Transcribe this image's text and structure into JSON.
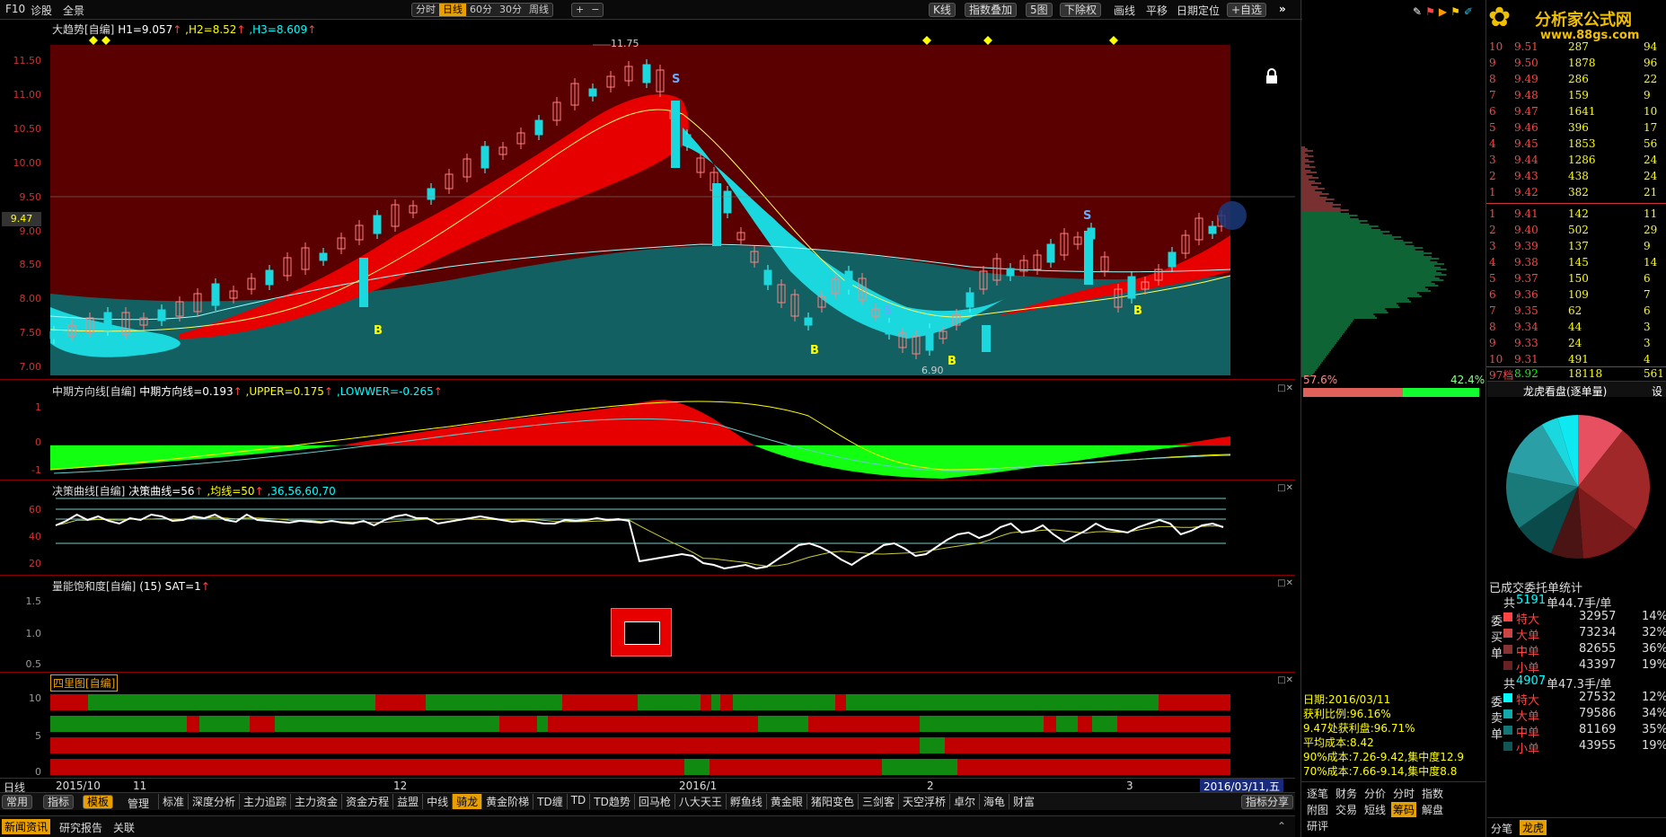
{
  "toolbar": {
    "f10": "F10",
    "diag": "诊股",
    "full": "全景",
    "periods": [
      "分时",
      "日线",
      "60分",
      "30分",
      "周线"
    ],
    "active_period": "日线",
    "zoom_in": "+",
    "zoom_out": "−",
    "right": [
      "K线",
      "指数叠加",
      "5图",
      "下除权",
      "画线",
      "平移",
      "日期定位",
      "+自选"
    ]
  },
  "main": {
    "title": "大趋势[自编]",
    "h1": "H1=9.057",
    "h2": ",H2=8.52",
    "h3": ",H3=8.609",
    "yticks": [
      "11.50",
      "11.00",
      "10.50",
      "10.00",
      "9.50",
      "9.00",
      "8.50",
      "8.00",
      "7.50",
      "7.00"
    ],
    "cur_price": "9.47",
    "high_label": "11.75",
    "low_label": "6.90",
    "s_label": "S",
    "b_label": "B"
  },
  "p2": {
    "title": "中期方向线[自编]",
    "v1": "中期方向线=0.193",
    "v2": ",UPPER=0.175",
    "v3": ",LOWWER=-0.265",
    "yticks": [
      "1",
      "0",
      "-1"
    ]
  },
  "p3": {
    "title": "决策曲线[自编]",
    "v1": "决策曲线=56",
    "v2": ",均线=50",
    "v3": ",36,56,60,70",
    "yticks": [
      "60",
      "40",
      "20"
    ]
  },
  "p4": {
    "title": "量能饱和度[自编]",
    "v1": "(15)",
    "v2": "SAT=1",
    "yticks": [
      "1.5",
      "1.0",
      "0.5"
    ]
  },
  "p5": {
    "title": "四里图[自编]",
    "yticks": [
      "10",
      "5",
      "0"
    ]
  },
  "xaxis": {
    "period": "日线",
    "labels": [
      "2015/10",
      "11",
      "12",
      "2016/1",
      "2",
      "3"
    ],
    "cur_date": "2016/03/11,五"
  },
  "bottom_tabs": {
    "common": "常用",
    "indicator": "指标",
    "template": "模板",
    "manage": "管理",
    "items": [
      "标准",
      "深度分析",
      "主力追踪",
      "主力资金",
      "资金方程",
      "益盟",
      "中线",
      "骑龙",
      "黄金阶梯",
      "TD缠",
      "TD",
      "TD趋势",
      "回马枪",
      "八大天王",
      "孵鱼线",
      "黄金眼",
      "猪阳变色",
      "三剑客",
      "天空浮桥",
      "卓尔",
      "海龟",
      "财富"
    ],
    "active": "骑龙",
    "share": "指标分享"
  },
  "news_tabs": [
    "新闻资讯",
    "研究报告",
    "关联"
  ],
  "chips": {
    "pct_left": "57.6%",
    "pct_right": "42.4%",
    "info": [
      "日期:2016/03/11",
      "获利比例:96.16%",
      "9.47处获利盘:96.71%",
      "平均成本:8.42",
      "90%成本:7.26-9.42,集中度12.9",
      "70%成本:7.66-9.14,集中度8.8"
    ],
    "tabs": [
      "逐笔",
      "财务",
      "分价",
      "分时",
      "指数",
      "附图",
      "交易",
      "短线",
      "筹码",
      "解盘",
      "研评"
    ],
    "active_tab": "筹码"
  },
  "orderbook": {
    "rows": [
      {
        "n": "10",
        "p": "9.51",
        "v": "287",
        "c": "94"
      },
      {
        "n": "9",
        "p": "9.50",
        "v": "1878",
        "c": "96"
      },
      {
        "n": "8",
        "p": "9.49",
        "v": "286",
        "c": "22"
      },
      {
        "n": "7",
        "p": "9.48",
        "v": "159",
        "c": "9"
      },
      {
        "n": "6",
        "p": "9.47",
        "v": "1641",
        "c": "10"
      },
      {
        "n": "5",
        "p": "9.46",
        "v": "396",
        "c": "17"
      },
      {
        "n": "4",
        "p": "9.45",
        "v": "1853",
        "c": "56"
      },
      {
        "n": "3",
        "p": "9.44",
        "v": "1286",
        "c": "24"
      },
      {
        "n": "2",
        "p": "9.43",
        "v": "438",
        "c": "24"
      },
      {
        "n": "1",
        "p": "9.42",
        "v": "382",
        "c": "21"
      },
      {
        "n": "1",
        "p": "9.41",
        "v": "142",
        "c": "11"
      },
      {
        "n": "2",
        "p": "9.40",
        "v": "502",
        "c": "29"
      },
      {
        "n": "3",
        "p": "9.39",
        "v": "137",
        "c": "9"
      },
      {
        "n": "4",
        "p": "9.38",
        "v": "145",
        "c": "14"
      },
      {
        "n": "5",
        "p": "9.37",
        "v": "150",
        "c": "6"
      },
      {
        "n": "6",
        "p": "9.36",
        "v": "109",
        "c": "7"
      },
      {
        "n": "7",
        "p": "9.35",
        "v": "62",
        "c": "6"
      },
      {
        "n": "8",
        "p": "9.34",
        "v": "44",
        "c": "3"
      },
      {
        "n": "9",
        "p": "9.33",
        "v": "24",
        "c": "3"
      },
      {
        "n": "10",
        "p": "9.31",
        "v": "491",
        "c": "4"
      }
    ],
    "total": {
      "n": "97档",
      "p": "8.92",
      "v": "18118",
      "c": "561"
    }
  },
  "dragon": {
    "title": "龙虎看盘(逐单量)",
    "set": "设",
    "stat_title": "已成交委托单统计",
    "buy": {
      "head_pre": "共",
      "count": "5191",
      "head_post": "单44.7手/单",
      "side": [
        "委",
        "买",
        "单"
      ],
      "rows": [
        {
          "k": "特大",
          "v": "32957",
          "p": "14%"
        },
        {
          "k": "大单",
          "v": "73234",
          "p": "32%"
        },
        {
          "k": "中单",
          "v": "82655",
          "p": "36%"
        },
        {
          "k": "小单",
          "v": "43397",
          "p": "19%"
        }
      ]
    },
    "sell": {
      "head_pre": "共",
      "count": "4907",
      "head_post": "单47.3手/单",
      "side": [
        "委",
        "卖",
        "单"
      ],
      "rows": [
        {
          "k": "特大",
          "v": "27532",
          "p": "12%"
        },
        {
          "k": "大单",
          "v": "79586",
          "p": "34%"
        },
        {
          "k": "中单",
          "v": "81169",
          "p": "35%"
        },
        {
          "k": "小单",
          "v": "43955",
          "p": "19%"
        }
      ]
    },
    "tabs": [
      "分笔",
      "龙虎"
    ],
    "active_tab": "龙虎"
  },
  "logo": {
    "name": "分析家公式网",
    "url": "www.88gs.com"
  },
  "colors": {
    "red": "#e60000",
    "cyan": "#1ad8dd",
    "teal": "#136062",
    "darkred": "#5a0000",
    "green": "#12ff12",
    "yellow": "#ff0",
    "orange": "#e8a000"
  }
}
